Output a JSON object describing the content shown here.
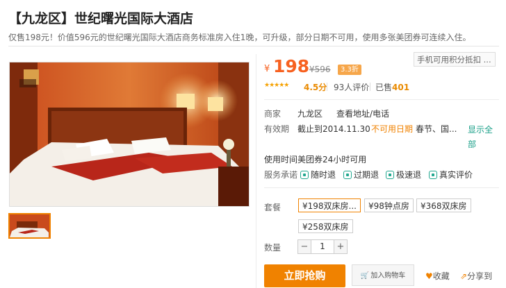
{
  "header": {
    "title": "【九龙区】世纪曙光国际大酒店",
    "subtitle": "仅售198元！价值596元的世纪曙光国际大酒店商务标准房入住1晚，可升级，部分日期不可用，使用多张美团券可连续入住。"
  },
  "price": {
    "currency": "¥",
    "current": "198",
    "original": "¥596",
    "discount": "3.3折",
    "mobile_points": "手机可用积分抵扣 ..."
  },
  "rating": {
    "score": "4.5分",
    "reviews": "93人评价",
    "sold_label": "已售",
    "sold_count": "401"
  },
  "merchant": {
    "label": "商家",
    "district": "九龙区",
    "address_link": "查看地址/电话"
  },
  "validity": {
    "label": "有效期",
    "until": "截止到2014.11.30",
    "unavailable_label": "不可用日期",
    "unavailable_dates": "春节、国...",
    "show_all": "显示全部"
  },
  "usage_time": "使用时间美团券24小时可用",
  "service": {
    "label": "服务承诺",
    "items": [
      "随时退",
      "过期退",
      "极速退",
      "真实评价"
    ]
  },
  "package": {
    "label": "套餐",
    "options": [
      "¥198双床房...",
      "¥98钟点房",
      "¥368双床房",
      "¥258双床房"
    ]
  },
  "quantity": {
    "label": "数量",
    "minus": "−",
    "value": "1",
    "plus": "+"
  },
  "actions": {
    "buy": "立即抢购",
    "cart": "加入购物车",
    "favorite": "收藏",
    "share": "分享到"
  },
  "colors": {
    "accent": "#f08200",
    "price": "#f76120",
    "link": "#1a9f88"
  }
}
